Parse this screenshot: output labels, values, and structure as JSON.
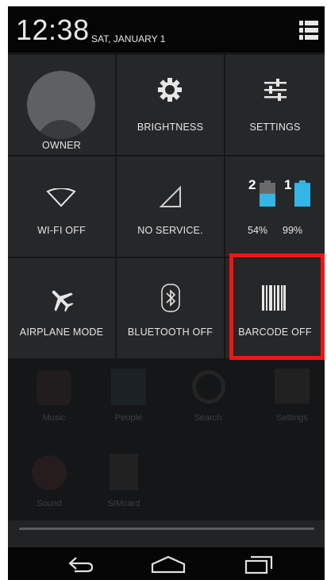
{
  "status_bar": {
    "time": "12:38",
    "date": "SAT, JANUARY 1"
  },
  "tiles": {
    "owner": {
      "label": "OWNER",
      "icon": "avatar-icon"
    },
    "brightness": {
      "label": "BRIGHTNESS",
      "icon": "brightness-icon"
    },
    "settings": {
      "label": "SETTINGS",
      "icon": "sliders-icon"
    },
    "wifi": {
      "label": "WI-FI OFF",
      "icon": "wifi-icon"
    },
    "signal": {
      "label": "NO SERVICE.",
      "icon": "signal-icon"
    },
    "battery": {
      "label_1": "54%",
      "label_2": "99%",
      "slot_1": "2",
      "slot_2": "1",
      "level_1": 0.54,
      "level_2": 0.99,
      "icon": "battery-icon"
    },
    "airplane": {
      "label": "AIRPLANE MODE",
      "icon": "airplane-icon"
    },
    "bluetooth": {
      "label": "BLUETOOTH OFF",
      "icon": "bluetooth-icon"
    },
    "barcode": {
      "label": "BARCODE OFF",
      "icon": "barcode-icon"
    }
  },
  "background_apps": [
    "Music",
    "People",
    "Search",
    "Settings",
    "Sound",
    "SIMcard"
  ],
  "colors": {
    "battery_accent": "#33b5e5",
    "highlight": "#f01616"
  }
}
